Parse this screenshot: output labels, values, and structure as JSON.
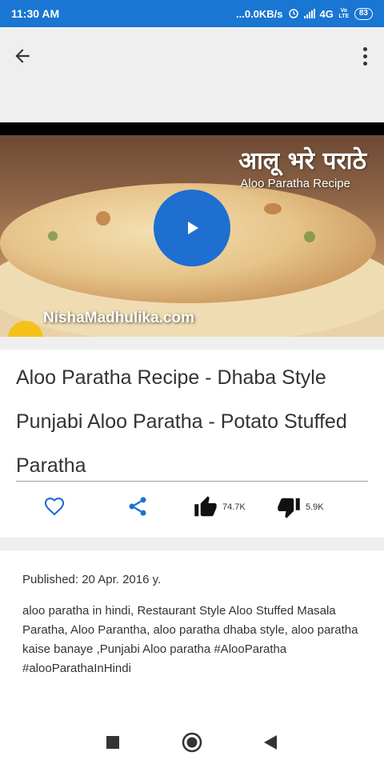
{
  "status_bar": {
    "time": "11:30 AM",
    "speed": "...0.0KB/s",
    "network": "4G",
    "volte": "Vo LTE",
    "battery": "83"
  },
  "video": {
    "overlay_title_hindi": "आलू भरे पराठे",
    "overlay_title_english": "Aloo Paratha Recipe",
    "watermark": "NishaMadhulika.com",
    "play_icon": "play-icon"
  },
  "recipe": {
    "title": "Aloo Paratha Recipe - Dhaba Style Punjabi Aloo Paratha - Potato Stuffed Paratha",
    "likes": "74.7K",
    "dislikes": "5.9K"
  },
  "description": {
    "published": "Published: 20 Apr. 2016 y.",
    "text": "aloo paratha in hindi, Restaurant Style Aloo Stuffed Masala Paratha, Aloo Parantha, aloo paratha dhaba style, aloo paratha kaise banaye ,Punjabi Aloo paratha #AlooParatha #alooParathaInHindi"
  },
  "colors": {
    "status_bar": "#1976d2",
    "accent": "#1e6fd0",
    "background": "#efefef"
  }
}
